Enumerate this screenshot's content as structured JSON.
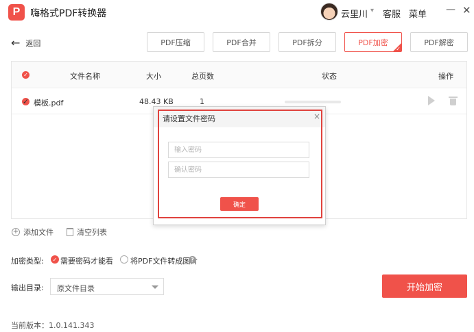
{
  "app": {
    "logo_letter": "P",
    "title": "嗨格式PDF转换器"
  },
  "user": {
    "name": "云里川",
    "caret": "▾"
  },
  "header": {
    "kefu": "客服",
    "menu": "菜单",
    "minimize": "—",
    "close": "✕"
  },
  "toolbar": {
    "back_label": "返回",
    "tabs": [
      {
        "label": "PDF压缩"
      },
      {
        "label": "PDF合并"
      },
      {
        "label": "PDF拆分"
      },
      {
        "label": "PDF加密",
        "active": true
      },
      {
        "label": "PDF解密"
      }
    ]
  },
  "table": {
    "columns": {
      "name": "文件名称",
      "size": "大小",
      "pages": "总页数",
      "status": "状态",
      "actions": "操作"
    },
    "rows": [
      {
        "name": "模板.pdf",
        "size": "48.43 KB",
        "pages": "1",
        "progress": 0
      }
    ]
  },
  "list_actions": {
    "add": "添加文件",
    "clear": "清空列表"
  },
  "options": {
    "encrypt_type_label": "加密类型:",
    "option_password": "需要密码才能看",
    "option_image": "将PDF文件转成图片",
    "help": "?"
  },
  "output": {
    "label": "输出目录:",
    "value": "原文件目录"
  },
  "start_button": "开始加密",
  "version": "当前版本：1.0.141.343",
  "modal": {
    "title": "请设置文件密码",
    "close": "×",
    "password_placeholder": "输入密码",
    "confirm_placeholder": "确认密码",
    "ok": "确定"
  },
  "colors": {
    "accent": "#f0524a",
    "highlight_border": "#e0423d"
  },
  "icons": {
    "check": "✓",
    "back_arrow": "←",
    "plus": "+"
  }
}
